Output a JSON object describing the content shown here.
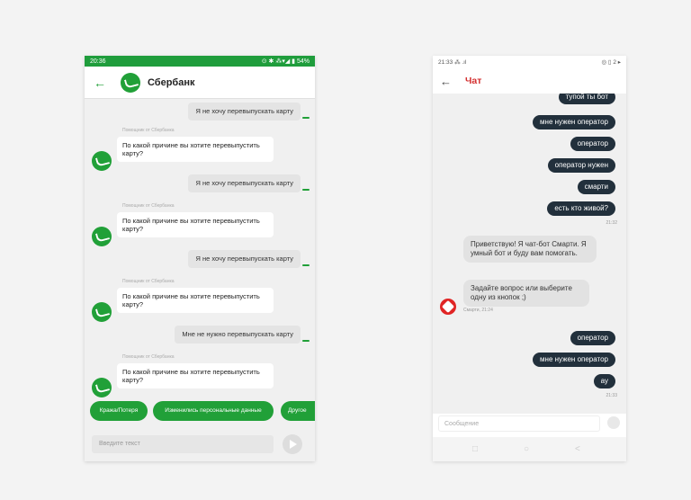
{
  "sberbank": {
    "status_time": "20:36",
    "status_right": "⊙ ✱ ⁂▾◢ ▮ 54%",
    "title": "Сбербанк",
    "bot_caption": "Помощник от Сбербанка",
    "bot_message": "По какой причине вы хотите перевыпустить карту?",
    "messages": {
      "u1": "Я не хочу перевыпускать карту",
      "u2": "Я не хочу перевыпускать карту",
      "u3": "Я не хочу перевыпускать карту",
      "u4": "Мне не нужно перевыпускать карту"
    },
    "chips": [
      "Кража/Потеря",
      "Изменились персональные данные",
      "Другое"
    ],
    "input_placeholder": "Введите текст",
    "colors": {
      "brand": "#21a038",
      "statusbar": "#1f9d3c"
    }
  },
  "chat": {
    "status_left": "21:33 ⁂ .ıl",
    "status_right": "◎ ▯ 2 ▸",
    "title": "Чат",
    "out1": [
      "тупой ты бот",
      "мне нужен оператор",
      "оператор",
      "оператор нужен",
      "смарти",
      "есть кто живой?"
    ],
    "time1": "21:32",
    "in1": "Приветствую! Я чат-бот Смарти. Я умный бот и буду вам помогать.",
    "in2": "Задайте вопрос или выберите одну из кнопок ;)",
    "bot_caption": "Смарти, 21:24",
    "out2": [
      "оператор",
      "мне нужен оператор",
      "ау"
    ],
    "time2": "21:33",
    "input_placeholder": "Сообщение",
    "colors": {
      "bubble_out": "#22303c",
      "accent": "#d32f2f"
    }
  }
}
